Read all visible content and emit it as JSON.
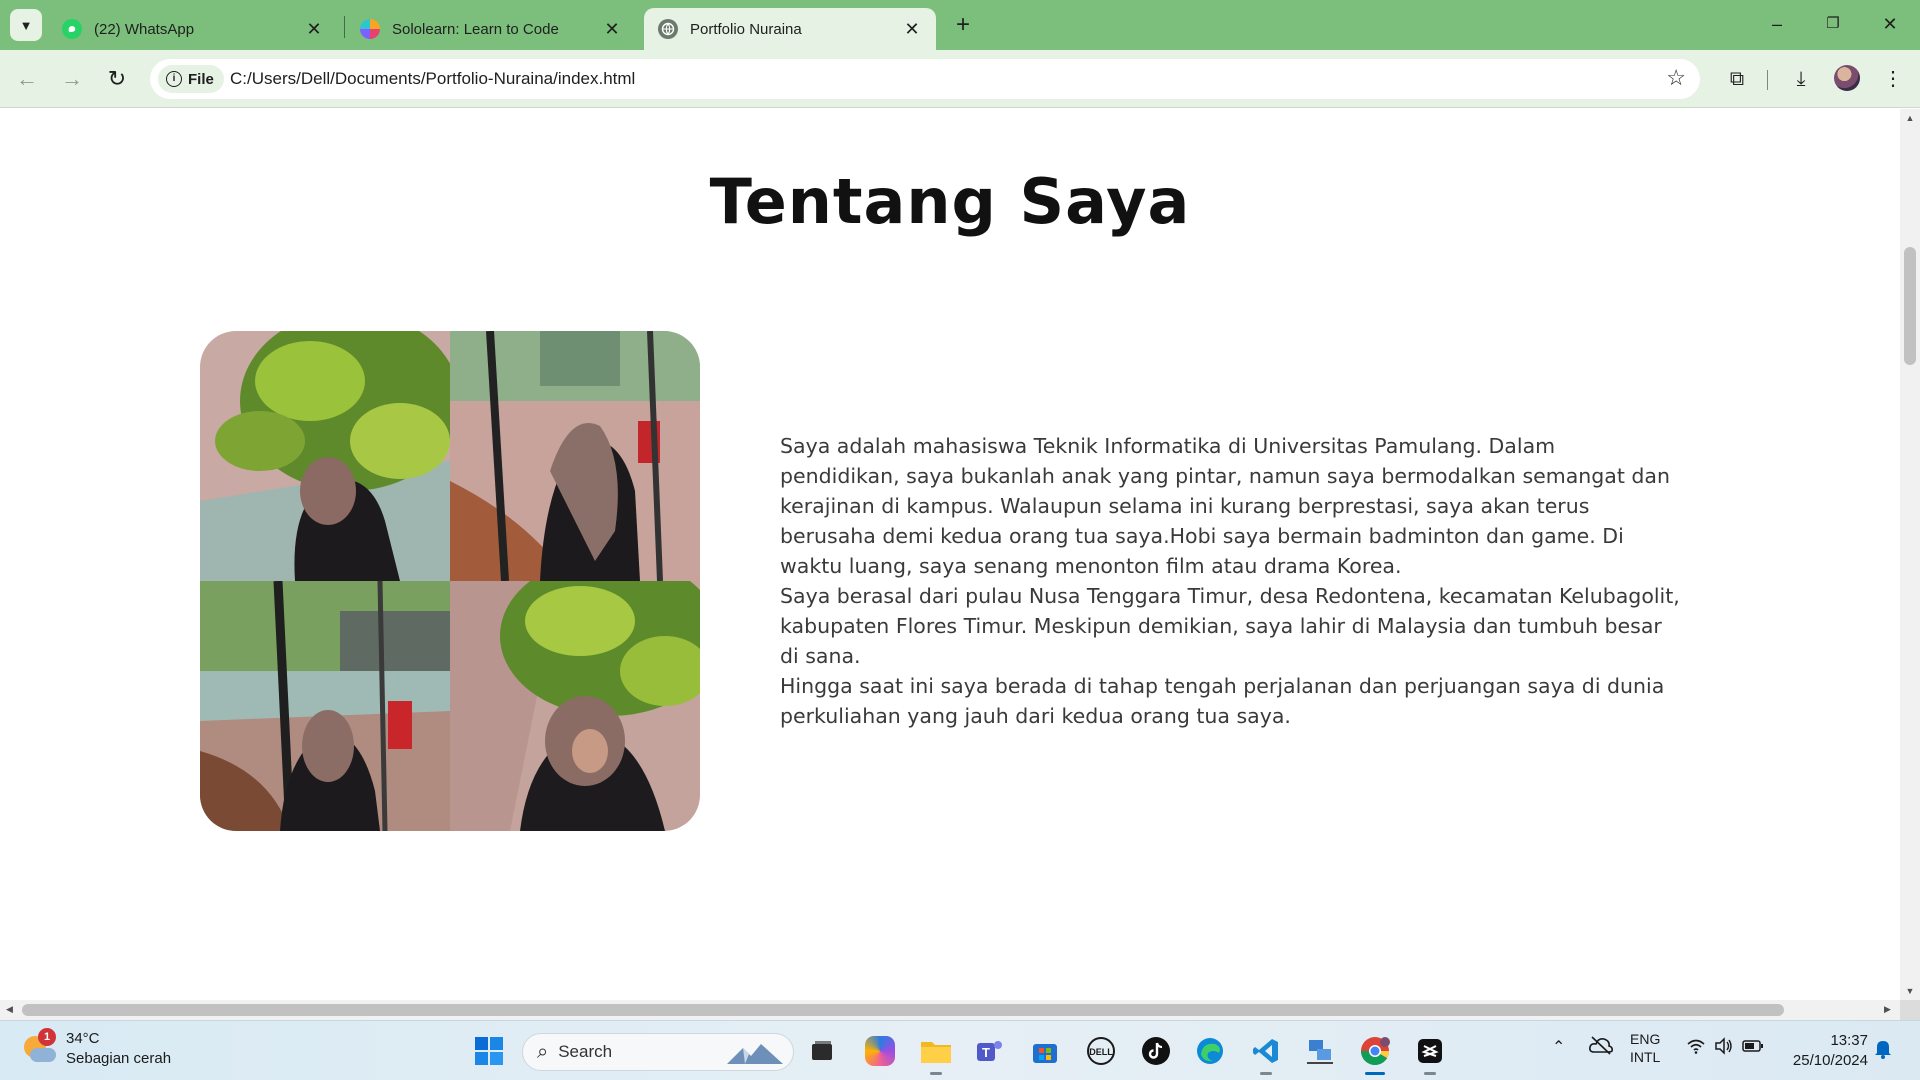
{
  "browser": {
    "tabs": [
      {
        "title": "(22) WhatsApp",
        "icon": "whatsapp-icon",
        "active": false
      },
      {
        "title": "Sololearn: Learn to Code",
        "icon": "sololearn-icon",
        "active": false
      },
      {
        "title": "Portfolio Nuraina",
        "icon": "globe-icon",
        "active": true
      }
    ],
    "chip_label": "File",
    "url": "C:/Users/Dell/Documents/Portfolio-Nuraina/index.html"
  },
  "page": {
    "title": "Tentang Saya",
    "paragraphs": [
      "Saya adalah mahasiswa Teknik Informatika di Universitas Pamulang. Dalam pendidikan, saya bukanlah anak yang pintar, namun saya bermodalkan semangat dan kerajinan di kampus. Walaupun selama ini kurang berprestasi, saya akan terus berusaha demi kedua orang tua saya.Hobi saya bermain badminton dan game. Di waktu luang, saya senang menonton film atau drama Korea.",
      "Saya berasal dari pulau Nusa Tenggara Timur, desa Redontena, kecamatan Kelubagolit, kabupaten Flores Timur. Meskipun demikian, saya lahir di Malaysia dan tumbuh besar di sana.",
      "Hingga saat ini saya berada di tahap tengah perjalanan dan perjuangan saya di dunia perkuliahan yang jauh dari kedua orang tua saya."
    ]
  },
  "taskbar": {
    "weather": {
      "temp": "34°C",
      "desc": "Sebagian cerah",
      "badge": "1"
    },
    "search_placeholder": "Search",
    "language": {
      "lang": "ENG",
      "layout": "INTL"
    },
    "time": "13:37",
    "date": "25/10/2024"
  },
  "colors": {
    "tabstrip": "#7cbf7c",
    "toolbar": "#e6f2e3",
    "heading": "#111111",
    "body_text": "#3a3a3a"
  }
}
